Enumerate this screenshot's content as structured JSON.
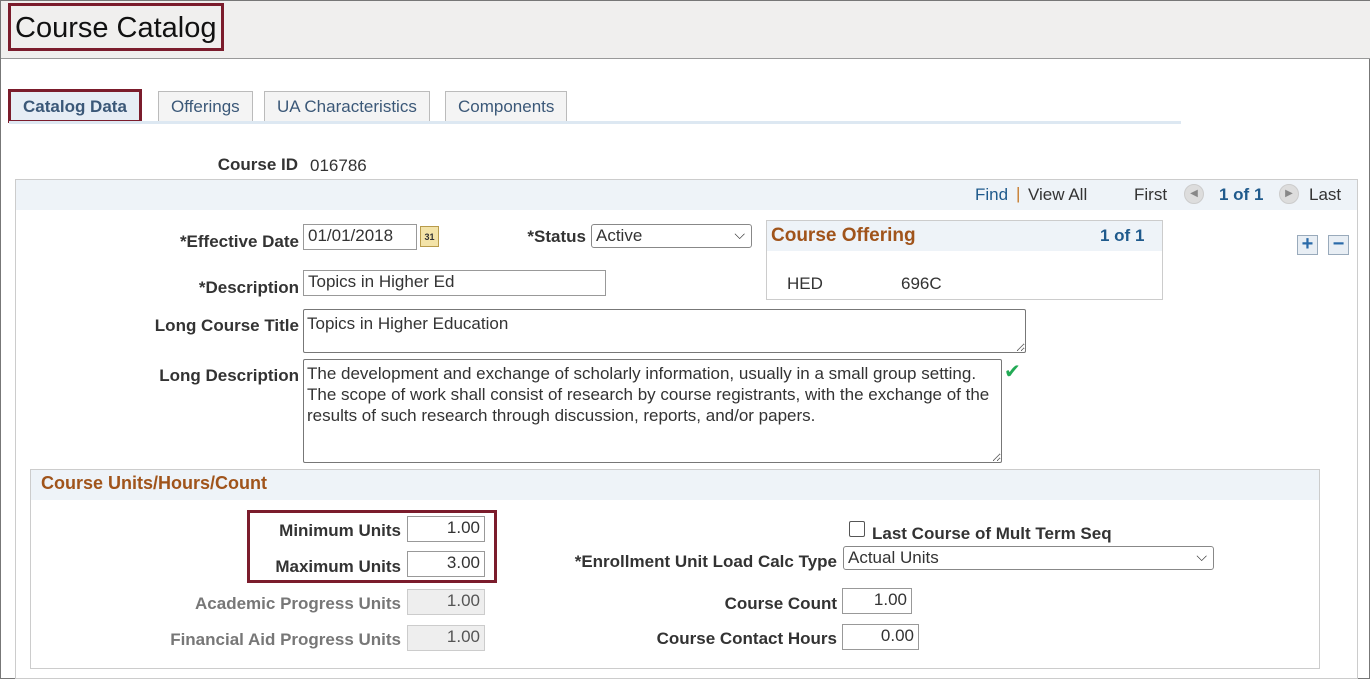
{
  "header": {
    "title": "Course Catalog"
  },
  "tabs": [
    {
      "label": "Catalog Data"
    },
    {
      "label": "Offerings"
    },
    {
      "label": "UA Characteristics"
    },
    {
      "label": "Components"
    }
  ],
  "course_id": {
    "label": "Course ID",
    "value": "016786"
  },
  "nav": {
    "find": "Find",
    "view_all": "View All",
    "first": "First",
    "count": "1 of 1",
    "last": "Last"
  },
  "form": {
    "effective_date": {
      "label": "*Effective Date",
      "value": "01/01/2018"
    },
    "status": {
      "label": "*Status",
      "value": "Active"
    },
    "description": {
      "label": "*Description",
      "value": "Topics in Higher Ed"
    },
    "long_title": {
      "label": "Long Course Title",
      "value": "Topics in Higher Education"
    },
    "long_description": {
      "label": "Long Description",
      "value": "The development and exchange of scholarly information, usually in a small group setting. The scope of work shall consist of research by course registrants, with the exchange of the results of such research through discussion, reports, and/or papers."
    }
  },
  "offering": {
    "title": "Course Offering",
    "count": "1 of 1",
    "subject": "HED",
    "catalog_nbr": "696C"
  },
  "units": {
    "title": "Course Units/Hours/Count",
    "min": {
      "label": "Minimum Units",
      "value": "1.00"
    },
    "max": {
      "label": "Maximum Units",
      "value": "3.00"
    },
    "academic": {
      "label": "Academic Progress Units",
      "value": "1.00"
    },
    "finaid": {
      "label": "Financial Aid Progress Units",
      "value": "1.00"
    },
    "last_course": {
      "label": "Last Course of Mult Term Seq",
      "checked": false
    },
    "load_calc": {
      "label": "*Enrollment Unit Load Calc Type",
      "value": "Actual Units"
    },
    "course_count": {
      "label": "Course Count",
      "value": "1.00"
    },
    "contact_hours": {
      "label": "Course Contact Hours",
      "value": "0.00"
    }
  },
  "colors": {
    "highlight": "#7b1c2c",
    "section_title": "#a0541b",
    "link": "#1f5a8c"
  }
}
